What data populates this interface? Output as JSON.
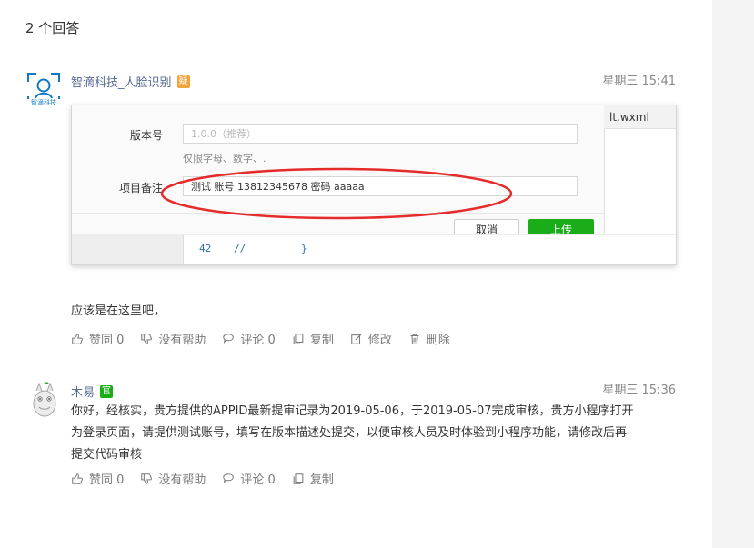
{
  "answers_count": "2 个回答",
  "answers": [
    {
      "author": "智滴科技_人脸识别",
      "avatar_text": "智滴科技",
      "badge": "疑",
      "time": "星期三 15:41",
      "embedded": {
        "file_tab": "lt.wxml",
        "version_label": "版本号",
        "version_placeholder": "1.0.0（推荐）",
        "version_hint": "仅限字母、数字、.",
        "note_label": "项目备注",
        "note_value": "测试 账号 13812345678  密码 aaaaa",
        "cancel_label": "取消",
        "upload_label": "上传",
        "code_line_number": "42",
        "code_comment": "//",
        "code_brace": "}"
      },
      "text": "应该是在这里吧，",
      "actions": {
        "like": "赞同 0",
        "unhelpful": "没有帮助",
        "comment": "评论 0",
        "copy": "复制",
        "edit": "修改",
        "delete": "删除"
      }
    },
    {
      "author": "木易",
      "badge": "官",
      "time": "星期三 15:36",
      "text": "你好，经核实，贵方提供的APPID最新提审记录为2019-05-06，于2019-05-07完成审核，贵方小程序打开\n为登录页面，请提供测试账号，填写在版本描述处提交，以便审核人员及时体验到小程序功能，请修改后再\n提交代码审核",
      "actions": {
        "like": "赞同 0",
        "unhelpful": "没有帮助",
        "comment": "评论 0",
        "copy": "复制"
      }
    }
  ],
  "colors": {
    "link": "#576b95",
    "green": "#1aad19",
    "orange": "#f2a33a",
    "annotation_red": "#e62b2b"
  },
  "icons": {
    "like": "thumbs-up-icon",
    "unhelpful": "thumbs-down-icon",
    "comment": "comment-icon",
    "copy": "copy-icon",
    "edit": "edit-icon",
    "delete": "trash-icon"
  }
}
